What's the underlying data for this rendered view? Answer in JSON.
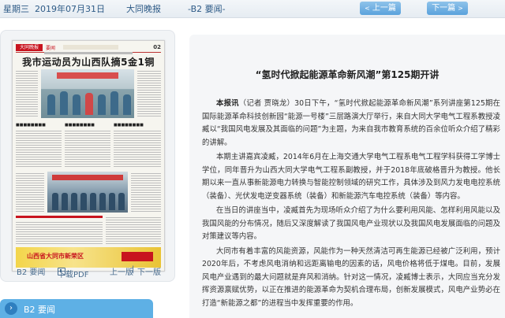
{
  "header": {
    "weekday": "星期三",
    "date": "2019年07月31日",
    "paper": "大同晚报",
    "page": "-B2 要闻-",
    "prev_label": "上一篇",
    "next_label": "下一篇"
  },
  "thumbnail": {
    "logo": "大同晚报",
    "section": "要闻",
    "page_no": "02",
    "headline": "我市运动员为山西队摘5金1铜",
    "ad_text": "山西省大同市新荣区"
  },
  "left_links": {
    "page": "B2 要闻",
    "download": "下载PDF",
    "prev_page": "上一版",
    "next_page": "下一版",
    "separator": "|"
  },
  "section_bar": {
    "label": "B2 要闻"
  },
  "article": {
    "title": "“氢时代掀起能源革命新风潮”第125期开讲",
    "p1_lead": "本报讯",
    "p1_rest": "（记者 贾晓龙）30日下午，“氢时代掀起能源革命新风潮”系列讲座第125期在国际能源革命科技创新园“能源一号楼”三层路演大厅举行，来自大同大学电气工程系教授凌臧以“我国风电发展及其面临的问题”为主题，为来自我市教育系统的百余位听众介绍了精彩的讲解。",
    "p2": "本期主讲嘉宾凌臧，2014年6月在上海交通大学电气工程系电气工程学科获得工学博士学位，同年晋升为山西大同大学电气工程系副教授，并于2018年底破格晋升为教授。他长期以来一直从事新能源电力转换与智能控制领域的研究工作，具体涉及到风力发电电控系统（装备）、光伏发电逆变器系统（装备）和新能源汽车电控系统（装备）等内容。",
    "p3": "在当日的讲座当中，凌臧首先为现场听众介绍了为什么要利用风能、怎样利用风能以及我国风能的分布情况，随后又深度解读了我国风电产业现状以及我国风电发展面临的问题及对策建议等内容。",
    "p4": "大同市有着丰富的风能资源，风能作为一种天然清洁可再生能源已经被广泛利用，预计2020年后，不考虑风电消纳和远距离输电的因素的话，风电价格将低于煤电。目前，发展风电产业遇到的最大问题就是弃风和消纳。针对这一情况，凌臧博士表示，大同应当充分发挥资源禀赋优势，以正在推进的能源革命为契机合理布局，创新发展模式，风电产业势必在打造“新能源之都”的进程当中发挥重要的作用。"
  },
  "colors": {
    "accent": "#5eb0e5",
    "header_text": "#2d5a86",
    "panel_bg": "#f2f4f6"
  }
}
